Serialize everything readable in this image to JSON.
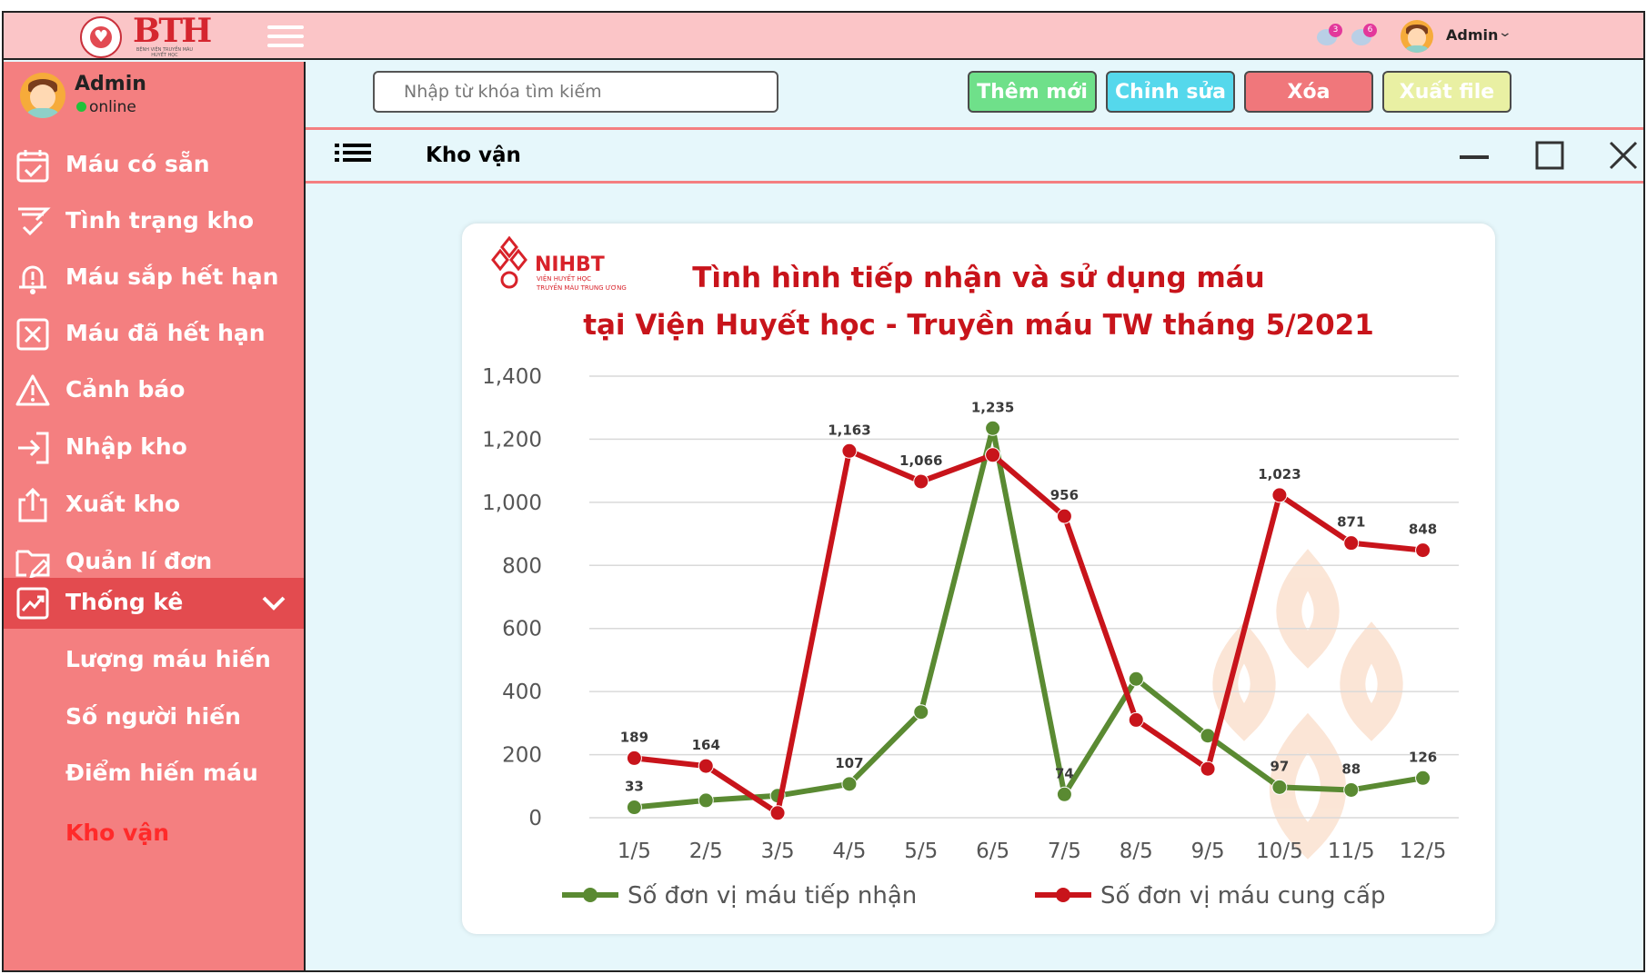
{
  "header": {
    "brand": "BTH",
    "brand_sub": "BỆNH VIỆN TRUYỀN MÁU HUYẾT HỌC",
    "notif_counts": [
      "3",
      "6"
    ],
    "user": "Admin"
  },
  "sidebar": {
    "user_name": "Admin",
    "status": "online",
    "items": [
      {
        "label": "Máu có sẵn",
        "icon": "calendar-check-icon"
      },
      {
        "label": "Tình trạng kho",
        "icon": "filter-check-icon"
      },
      {
        "label": "Máu sắp hết hạn",
        "icon": "bell-alert-icon"
      },
      {
        "label": "Máu đã hết hạn",
        "icon": "x-square-icon"
      },
      {
        "label": "Cảnh báo",
        "icon": "warning-triangle-icon"
      },
      {
        "label": "Nhập kho",
        "icon": "sign-in-icon"
      },
      {
        "label": "Xuất kho",
        "icon": "share-upload-icon"
      },
      {
        "label": "Quản lí đơn",
        "icon": "folder-edit-icon"
      },
      {
        "label": "Thống kê",
        "icon": "trend-chart-icon"
      }
    ],
    "sub_items": [
      {
        "label": "Lượng máu hiến"
      },
      {
        "label": "Số người hiến"
      },
      {
        "label": "Điểm hiến máu"
      },
      {
        "label": "Kho vận"
      }
    ]
  },
  "toolbar": {
    "search_placeholder": "Nhập từ khóa tìm kiếm",
    "add_label": "Thêm mới",
    "edit_label": "Chỉnh sửa",
    "delete_label": "Xóa",
    "export_label": "Xuất file"
  },
  "window": {
    "title": "Kho vận"
  },
  "colors": {
    "sidebar": "#f47f80",
    "topbar": "#fbc5c7",
    "content_bg": "#e6f7fb",
    "series_green": "#5a8a32",
    "series_red": "#c8141b"
  },
  "chart_data": {
    "type": "line",
    "logo_text": "NIHBT",
    "logo_sub1": "VIỆN HUYẾT HỌC",
    "logo_sub2": "TRUYỀN MÁU TRUNG ƯƠNG",
    "title_line1": "Tình hình tiếp nhận và sử dụng máu",
    "title_line2": "tại Viện Huyết học - Truyền máu TW tháng 5/2021",
    "categories": [
      "1/5",
      "2/5",
      "3/5",
      "4/5",
      "5/5",
      "6/5",
      "7/5",
      "8/5",
      "9/5",
      "10/5",
      "11/5",
      "12/5"
    ],
    "ylim": [
      0,
      1400
    ],
    "yticks": [
      "0",
      "200",
      "400",
      "600",
      "800",
      "1,000",
      "1,200",
      "1,400"
    ],
    "grid": true,
    "legend_position": "bottom",
    "series": [
      {
        "name": "Số đơn vị máu tiếp nhận",
        "color": "#5a8a32",
        "values": [
          33,
          55,
          70,
          107,
          335,
          1235,
          74,
          440,
          260,
          97,
          88,
          126
        ],
        "labels": [
          "33",
          "",
          "",
          "107",
          "",
          "1,235",
          "74",
          "",
          "",
          "97",
          "88",
          "126"
        ]
      },
      {
        "name": "Số đơn vị máu cung cấp",
        "color": "#c8141b",
        "values": [
          189,
          164,
          15,
          1163,
          1066,
          1150,
          956,
          310,
          155,
          1023,
          871,
          848
        ],
        "labels": [
          "189",
          "164",
          "",
          "1,163",
          "1,066",
          "",
          "956",
          "",
          "",
          "1,023",
          "871",
          "848"
        ]
      }
    ]
  }
}
